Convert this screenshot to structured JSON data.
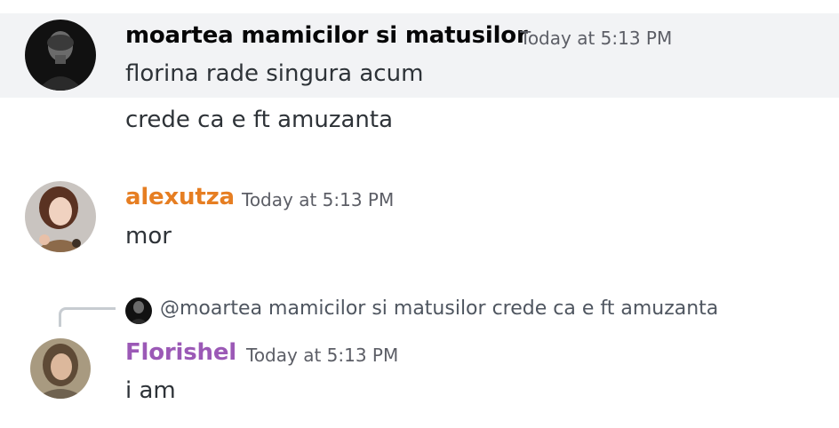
{
  "messages": [
    {
      "author": "moartea mamicilor si matusilor",
      "author_color": "#060607",
      "timestamp": "Today at 5:13 PM",
      "lines": [
        "florina rade singura acum",
        "crede ca e ft amuzanta"
      ]
    },
    {
      "author": "alexutza",
      "author_color": "#e67e22",
      "timestamp": "Today at 5:13 PM",
      "lines": [
        "mor"
      ]
    },
    {
      "reply": {
        "mention": "@moartea mamicilor si matusilor",
        "preview": "crede ca e ft amuzanta"
      },
      "author": "Florishel",
      "author_color": "#9b59b6",
      "timestamp": "Today at 5:13 PM",
      "lines": [
        "i am"
      ]
    }
  ]
}
